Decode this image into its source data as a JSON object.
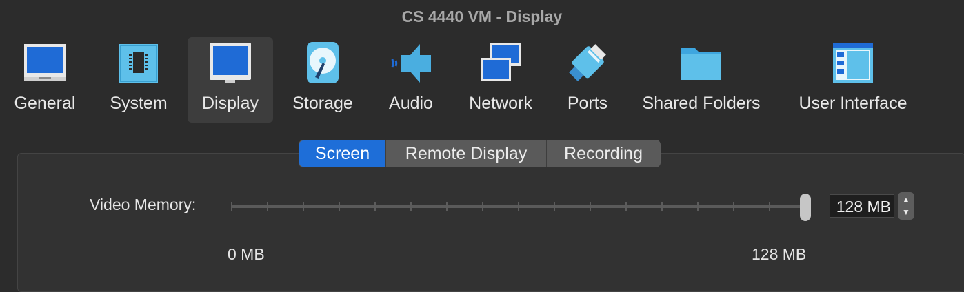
{
  "window": {
    "title": "CS 4440 VM - Display"
  },
  "toolbar": {
    "items": [
      {
        "label": "General",
        "icon": "general-icon"
      },
      {
        "label": "System",
        "icon": "system-icon"
      },
      {
        "label": "Display",
        "icon": "display-icon",
        "selected": true
      },
      {
        "label": "Storage",
        "icon": "storage-icon"
      },
      {
        "label": "Audio",
        "icon": "audio-icon"
      },
      {
        "label": "Network",
        "icon": "network-icon"
      },
      {
        "label": "Ports",
        "icon": "ports-icon"
      },
      {
        "label": "Shared Folders",
        "icon": "shared-folders-icon"
      },
      {
        "label": "User Interface",
        "icon": "user-interface-icon"
      }
    ]
  },
  "tabs": [
    {
      "label": "Screen",
      "active": true
    },
    {
      "label": "Remote Display"
    },
    {
      "label": "Recording"
    }
  ],
  "video_memory": {
    "label": "Video Memory:",
    "value": "128 MB",
    "slider_fraction": 1.0,
    "min_label": "0 MB",
    "max_label": "128 MB"
  },
  "colors": {
    "accent": "#1e6ed8",
    "icon_blue": "#1f6bd6",
    "background": "#2c2c2c"
  }
}
